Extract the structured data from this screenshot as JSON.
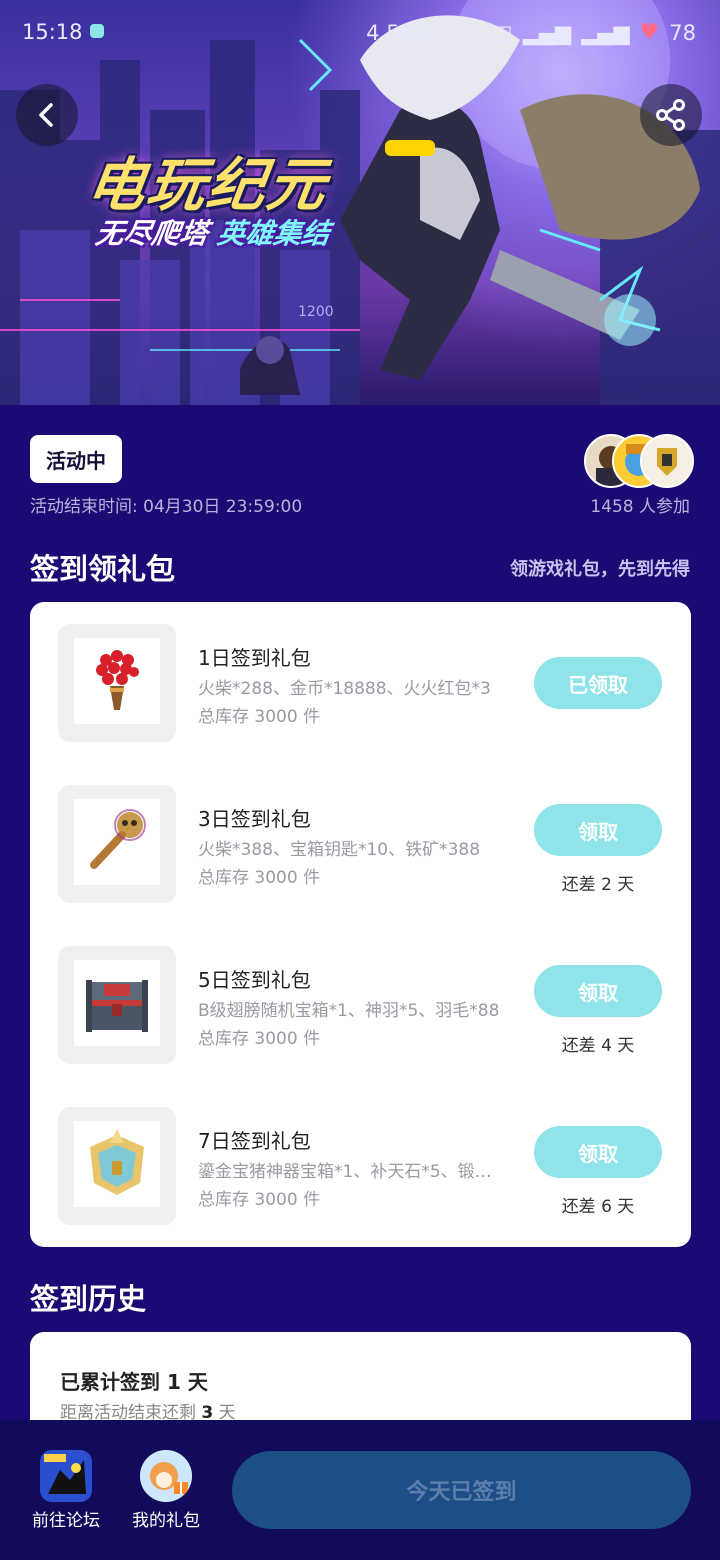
{
  "status_bar": {
    "time": "15:18",
    "net_speed": "4.5K/s",
    "battery": "78"
  },
  "banner": {
    "title": "电玩纪元",
    "subtitle_left": "无尽爬塔",
    "subtitle_right": "英雄集结",
    "tower_number": "1200"
  },
  "activity": {
    "status": "活动中",
    "end_time": "活动结束时间: 04月30日 23:59:00",
    "participants": "1458 人参加"
  },
  "signin_gifts": {
    "title": "签到领礼包",
    "hint": "领游戏礼包，先到先得",
    "gifts": [
      {
        "name": "1日签到礼包",
        "items": "火柴*288、金币*18888、火火红包*3",
        "stock": "总库存 3000 件",
        "button": "已领取",
        "days_left": "",
        "icon": "red-torch-icon"
      },
      {
        "name": "3日签到礼包",
        "items": "火柴*388、宝箱钥匙*10、铁矿*388",
        "stock": "总库存 3000 件",
        "button": "领取",
        "days_left": "还差 2 天",
        "icon": "skull-key-icon"
      },
      {
        "name": "5日签到礼包",
        "items": "B级翅膀随机宝箱*1、神羽*5、羽毛*88",
        "stock": "总库存 3000 件",
        "button": "领取",
        "days_left": "还差 4 天",
        "icon": "treasure-chest-icon"
      },
      {
        "name": "7日签到礼包",
        "items": "鎏金宝猪神器宝箱*1、补天石*5、锻…",
        "stock": "总库存 3000 件",
        "button": "领取",
        "days_left": "还差 6 天",
        "icon": "golden-chest-icon"
      }
    ]
  },
  "history": {
    "title": "签到历史",
    "line1": "已累计签到 1 天",
    "line2_prefix": "距离活动结束还剩 ",
    "line2_value": "3",
    "line2_suffix": " 天"
  },
  "bottom_bar": {
    "forum_label": "前往论坛",
    "gifts_label": "我的礼包",
    "checkin_label": "今天已签到"
  },
  "colors": {
    "page_bg": "#1b0a73",
    "claim_button": "#8ee4e8",
    "checkin_button": "#1d4e86"
  }
}
